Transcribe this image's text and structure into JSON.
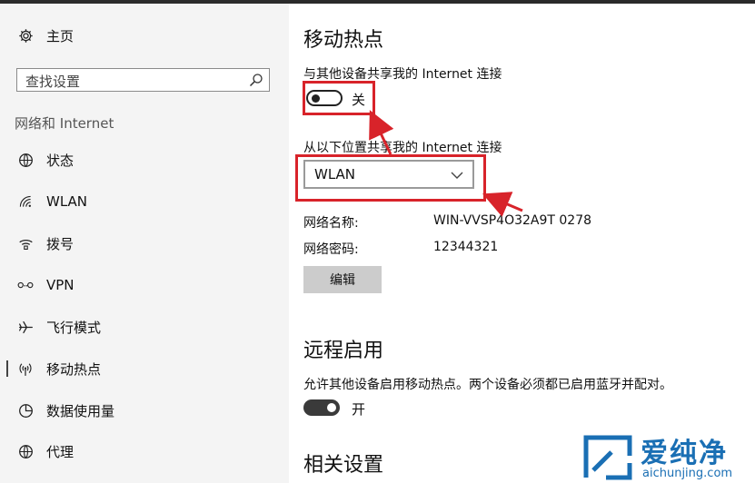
{
  "sidebar": {
    "home_label": "主页",
    "search_placeholder": "查找设置",
    "section_label": "网络和 Internet",
    "items": [
      {
        "label": "状态",
        "icon": "globe-status-icon"
      },
      {
        "label": "WLAN",
        "icon": "wifi-icon"
      },
      {
        "label": "拨号",
        "icon": "dialup-icon"
      },
      {
        "label": "VPN",
        "icon": "vpn-icon"
      },
      {
        "label": "飞行模式",
        "icon": "airplane-icon"
      },
      {
        "label": "移动热点",
        "icon": "hotspot-icon",
        "active": true
      },
      {
        "label": "数据使用量",
        "icon": "data-usage-icon"
      },
      {
        "label": "代理",
        "icon": "globe-proxy-icon"
      }
    ]
  },
  "main": {
    "title": "移动热点",
    "share_label": "与其他设备共享我的 Internet 连接",
    "share_toggle": {
      "state": "关",
      "on": false
    },
    "from_label": "从以下位置共享我的 Internet 连接",
    "from_value": "WLAN",
    "network_name_label": "网络名称:",
    "network_name_value": "WIN-VVSP4O32A9T 0278",
    "network_password_label": "网络密码:",
    "network_password_value": "12344321",
    "edit_button": "编辑",
    "remote_title": "远程启用",
    "remote_desc": "允许其他设备启用移动热点。两个设备必须都已启用蓝牙并配对。",
    "remote_toggle": {
      "state": "开",
      "on": true
    },
    "related_title": "相关设置"
  },
  "watermark": {
    "title": "爱纯净",
    "url": "aichunjing.com"
  },
  "colors": {
    "sidebar_bg": "#f4f4f4",
    "annotation_red": "#d8232a",
    "watermark_blue": "#1a6fb4"
  }
}
